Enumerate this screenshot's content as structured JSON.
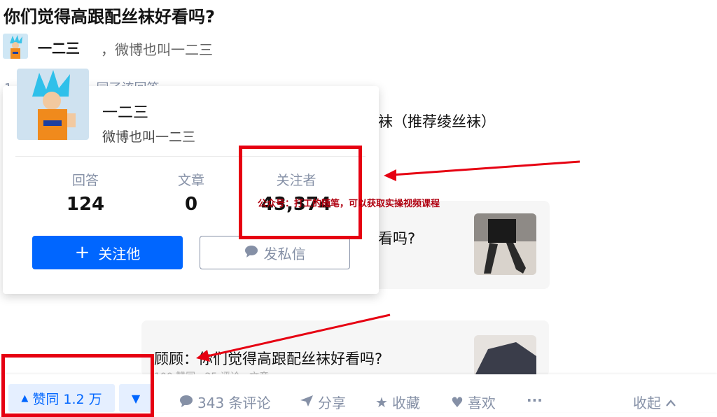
{
  "question": {
    "title": "你们觉得高跟配丝袜好看吗?"
  },
  "author": {
    "name": "一二三",
    "bio_inline": "，微博也叫一二三"
  },
  "hidden_text": {
    "prefix": "1",
    "suffix": "同了该回答"
  },
  "answer_snippet": "袜（推荐绫丝袜）",
  "hover_card": {
    "name": "一二三",
    "bio": "微博也叫一二三",
    "stats": [
      {
        "label": "回答",
        "value": "124"
      },
      {
        "label": "文章",
        "value": "0"
      },
      {
        "label": "关注者",
        "value": "43,374"
      }
    ],
    "follow_label": "关注他",
    "message_label": "发私信"
  },
  "related": [
    {
      "text": "看吗?"
    },
    {
      "text": "顾顾：你们觉得高跟配丝袜好看吗?",
      "meta": "100 赞同 · 25 评论 · 文章"
    }
  ],
  "watermark": "公众号：打工的随笔，可以获取实操视频课程",
  "action_bar": {
    "vote_up": "赞同 1.2 万",
    "comments": "343 条评论",
    "share": "分享",
    "favorite": "收藏",
    "like": "喜欢",
    "more": "···",
    "collapse": "收起"
  },
  "colors": {
    "brand_blue": "#0066ff",
    "annotation_red": "#e60012",
    "muted": "#8590a6"
  },
  "icons": [
    "triangle-up-icon",
    "triangle-down-icon",
    "comment-icon",
    "share-icon",
    "star-icon",
    "heart-icon",
    "chevron-up-icon",
    "plus-icon",
    "chat-bubble-icon"
  ]
}
